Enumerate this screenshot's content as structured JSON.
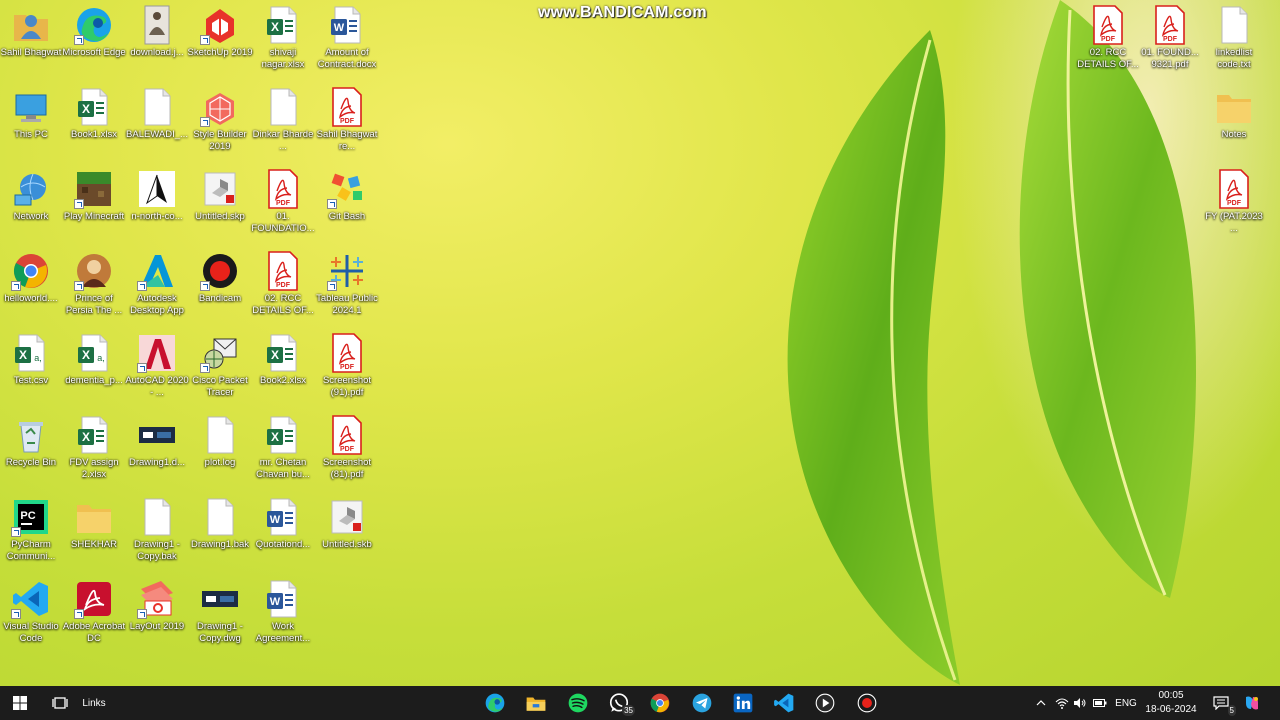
{
  "watermark": "www.BANDICAM.com",
  "icons": [
    {
      "label": "Sahil Bhagwat",
      "icon": "user-folder-icon"
    },
    {
      "label": "Microsoft Edge",
      "icon": "edge-icon"
    },
    {
      "label": "download.j...",
      "icon": "image-file-icon"
    },
    {
      "label": "SketchUp 2019",
      "icon": "sketchup-icon"
    },
    {
      "label": "shivaji nagar.xlsx",
      "icon": "excel-icon"
    },
    {
      "label": "Amount of Contract.docx",
      "icon": "word-icon"
    },
    {
      "label": "This PC",
      "icon": "this-pc-icon"
    },
    {
      "label": "Book1.xlsx",
      "icon": "excel-icon"
    },
    {
      "label": "BALEWADI_...",
      "icon": "blank-file-icon"
    },
    {
      "label": "Style Builder 2019",
      "icon": "style-builder-icon"
    },
    {
      "label": "Dinkar Bharde ...",
      "icon": "blank-file-icon"
    },
    {
      "label": "Sahil Bhagwat re...",
      "icon": "pdf-icon"
    },
    {
      "label": "Network",
      "icon": "network-icon"
    },
    {
      "label": "Play Minecraft",
      "icon": "minecraft-icon"
    },
    {
      "label": "n-north-co...",
      "icon": "north-arrow-icon"
    },
    {
      "label": "Untitled.skp",
      "icon": "skp-file-icon"
    },
    {
      "label": "01. FOUNDATIO...",
      "icon": "pdf-icon"
    },
    {
      "label": "Git Bash",
      "icon": "git-bash-icon"
    },
    {
      "label": "helloworld....",
      "icon": "chrome-icon"
    },
    {
      "label": "Prince of Persia The ...",
      "icon": "game-icon"
    },
    {
      "label": "Autodesk Desktop App",
      "icon": "autodesk-icon"
    },
    {
      "label": "Bandicam",
      "icon": "bandicam-icon"
    },
    {
      "label": "02. RCC DETAILS OF...",
      "icon": "pdf-icon"
    },
    {
      "label": "Tableau Public 2024.1",
      "icon": "tableau-icon"
    },
    {
      "label": "Test.csv",
      "icon": "excel-csv-icon"
    },
    {
      "label": "dementia_p...",
      "icon": "excel-csv-icon"
    },
    {
      "label": "AutoCAD 2020 - ...",
      "icon": "autocad-icon"
    },
    {
      "label": "Cisco Packet Tracer",
      "icon": "packet-tracer-icon"
    },
    {
      "label": "Book2.xlsx",
      "icon": "excel-icon"
    },
    {
      "label": "Screenshot (91).pdf",
      "icon": "pdf-icon"
    },
    {
      "label": "Recycle Bin",
      "icon": "recycle-bin-icon"
    },
    {
      "label": "FDV assign 2.xlsx",
      "icon": "excel-icon"
    },
    {
      "label": "Drawing1.d...",
      "icon": "dwg-file-icon"
    },
    {
      "label": "plot.log",
      "icon": "blank-file-icon"
    },
    {
      "label": "mr. Chetan Chavan bu...",
      "icon": "excel-icon"
    },
    {
      "label": "Screenshot (81).pdf",
      "icon": "pdf-icon"
    },
    {
      "label": "PyCharm Communi...",
      "icon": "pycharm-icon"
    },
    {
      "label": "SHEKHAR",
      "icon": "folder-icon"
    },
    {
      "label": "Drawing1 - Copy.bak",
      "icon": "blank-file-icon"
    },
    {
      "label": "Drawing1.bak",
      "icon": "blank-file-icon"
    },
    {
      "label": "Quotationd...",
      "icon": "word-icon"
    },
    {
      "label": "Untitled.skb",
      "icon": "skp-file-icon"
    },
    {
      "label": "Visual Studio Code",
      "icon": "vscode-icon"
    },
    {
      "label": "Adobe Acrobat DC",
      "icon": "acrobat-icon"
    },
    {
      "label": "LayOut 2019",
      "icon": "layout-icon"
    },
    {
      "label": "Drawing1 - Copy.dwg",
      "icon": "dwg-file-icon"
    },
    {
      "label": "Work Agreement...",
      "icon": "word-icon"
    },
    {
      "label": "02. RCC DETAILS OF...",
      "icon": "pdf-icon"
    },
    {
      "label": "01. FOUND... 9321.pdf",
      "icon": "pdf-icon"
    },
    {
      "label": "linkedlist code.txt",
      "icon": "blank-file-icon"
    },
    {
      "label": "Notes",
      "icon": "folder-icon"
    },
    {
      "label": "FY (PAT.2023 ...",
      "icon": "pdf-icon"
    }
  ],
  "taskbar": {
    "search_label": "Links",
    "apps": [
      "edge-icon",
      "file-explorer-icon",
      "spotify-icon",
      "whatsapp-icon",
      "chrome-icon",
      "telegram-icon",
      "linkedin-icon",
      "vscode-icon",
      "media-player-icon",
      "bandicam-icon"
    ],
    "whatsapp_badge": "35",
    "language": "ENG",
    "time": "00:05",
    "date": "18-06-2024",
    "notification_count": "5"
  },
  "colors": {
    "taskbar": "#1c1c1c",
    "excel": "#1d7044",
    "word": "#2b579a",
    "pdf": "#d9201c"
  }
}
